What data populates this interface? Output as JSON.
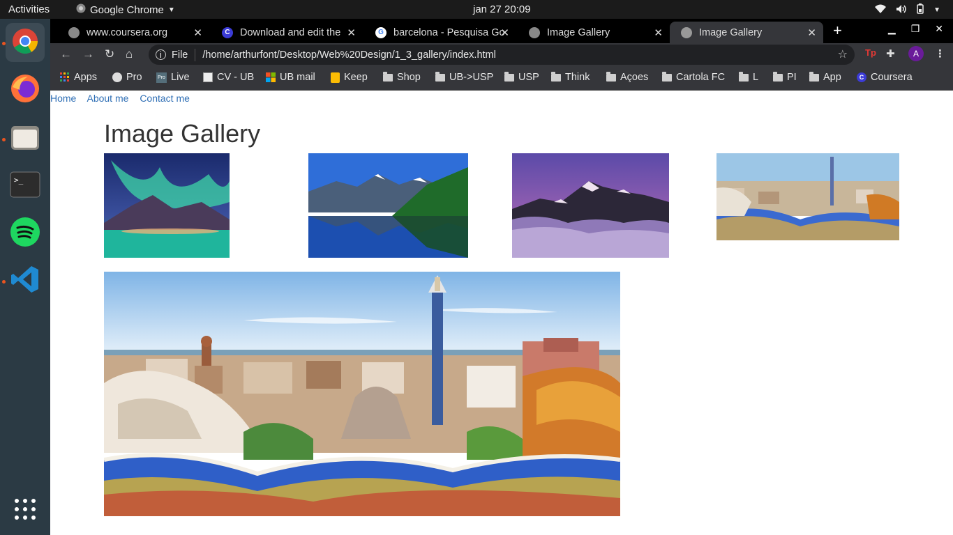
{
  "system": {
    "activities": "Activities",
    "app_name": "Google Chrome",
    "clock": "jan 27  20:09"
  },
  "tabs": [
    {
      "title": "www.coursera.org",
      "favicon": "globe-icon"
    },
    {
      "title": "Download and edit the",
      "favicon": "coursera-icon"
    },
    {
      "title": "barcelona - Pesquisa Go",
      "favicon": "google-icon"
    },
    {
      "title": "Image Gallery",
      "favicon": "globe-icon"
    },
    {
      "title": "Image Gallery",
      "favicon": "globe-icon",
      "active": true
    }
  ],
  "toolbar": {
    "scheme_label": "File",
    "url": "/home/arthurfont/Desktop/Web%20Design/1_3_gallery/index.html",
    "profile_initial": "A"
  },
  "bookmarks": [
    {
      "label": "Apps",
      "icon": "apps-grid-icon"
    },
    {
      "label": "Pro",
      "icon": "globe-icon"
    },
    {
      "label": "Live",
      "icon": "pro-live-icon"
    },
    {
      "label": "CV - UB",
      "icon": "cv-icon"
    },
    {
      "label": "UB mail",
      "icon": "microsoft-icon"
    },
    {
      "label": "Keep",
      "icon": "keep-icon"
    },
    {
      "label": "Shop",
      "icon": "folder-icon"
    },
    {
      "label": "UB->USP",
      "icon": "folder-icon"
    },
    {
      "label": "USP",
      "icon": "folder-icon"
    },
    {
      "label": "Think",
      "icon": "folder-icon"
    },
    {
      "label": "Açoes",
      "icon": "folder-icon"
    },
    {
      "label": "Cartola FC",
      "icon": "folder-icon"
    },
    {
      "label": "L",
      "icon": "folder-icon"
    },
    {
      "label": "PI",
      "icon": "folder-icon"
    },
    {
      "label": "App",
      "icon": "folder-icon"
    },
    {
      "label": "Coursera",
      "icon": "coursera-icon"
    }
  ],
  "page": {
    "nav": [
      "Home",
      "About me",
      "Contact me"
    ],
    "title": "Image Gallery",
    "images": [
      "aurora",
      "mountain-lake",
      "everest-clouds",
      "park-guell-small",
      "park-guell-large"
    ]
  },
  "colors": {
    "link": "#2f6fb5",
    "profile": "#6a1b9a",
    "ubuntu_accent": "#e95420"
  }
}
